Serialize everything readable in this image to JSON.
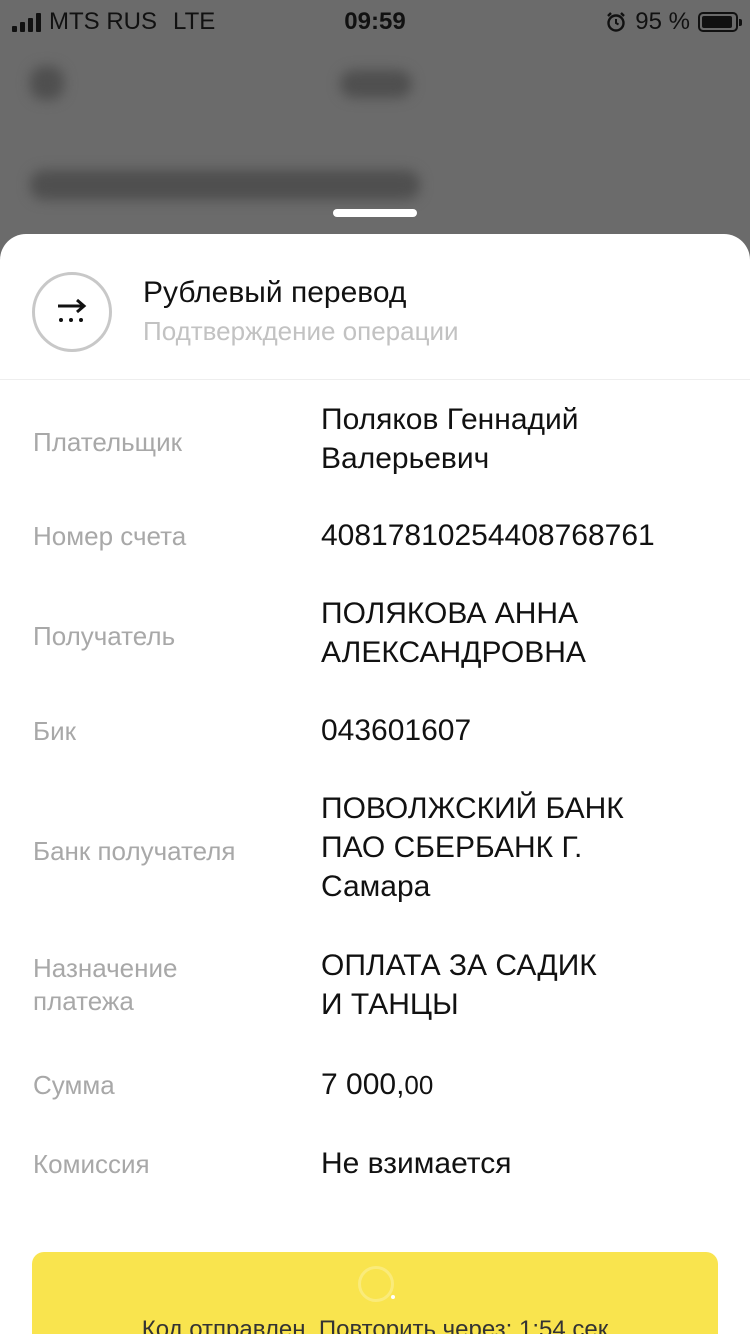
{
  "status_bar": {
    "carrier": "MTS RUS",
    "network": "LTE",
    "time": "09:59",
    "battery": "95 %",
    "battery_level": 0.95,
    "icons": [
      "signal-icon",
      "alarm-icon",
      "battery-icon"
    ]
  },
  "sheet": {
    "title": "Рублевый перевод",
    "subtitle": "Подтверждение операции",
    "icon": "transfer-icon"
  },
  "details": [
    {
      "label": "Плательщик",
      "value": "Поляков Геннадий\nВалерьевич"
    },
    {
      "label": "Номер счета",
      "value": "40817810254408768761"
    },
    {
      "label": "Получатель",
      "value": "ПОЛЯКОВА АННА\nАЛЕКСАНДРОВНА"
    },
    {
      "label": "Бик",
      "value": "043601607"
    },
    {
      "label": "Банк получателя",
      "value": "ПОВОЛЖСКИЙ БАНК\nПАО СБЕРБАНК Г.\nСамара"
    },
    {
      "label": "Назначение\nплатежа",
      "value": "ОПЛАТА ЗА САДИК\nИ ТАНЦЫ"
    },
    {
      "label": "Сумма",
      "value_main": "7 000,",
      "value_kop": "00"
    },
    {
      "label": "Комиссия",
      "value": "Не взимается"
    }
  ],
  "code_button": {
    "text": "Код отправлен. Повторить через: 1:54 сек",
    "color": "#f9e44e"
  }
}
